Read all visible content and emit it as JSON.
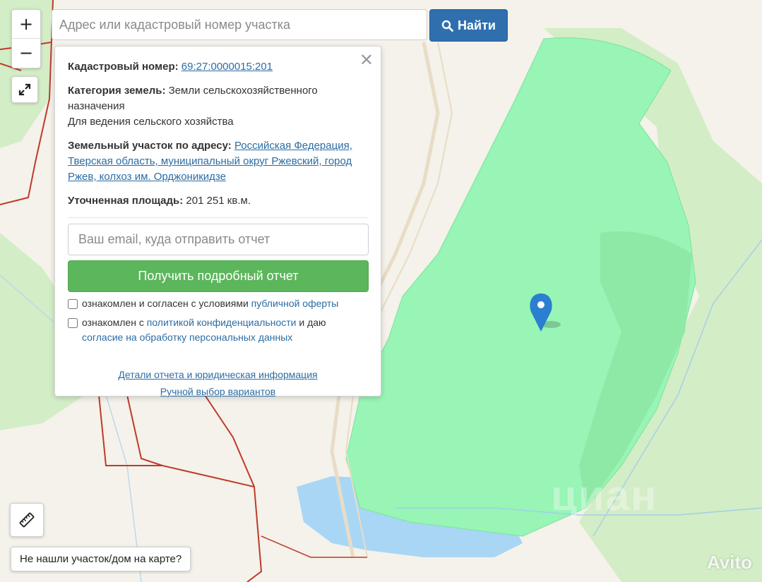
{
  "search": {
    "placeholder": "Адрес или кадастровый номер участка",
    "button_label": "Найти"
  },
  "map_controls": {
    "zoom_in": "+",
    "zoom_out": "−"
  },
  "popup": {
    "cadastral_label": "Кадастровый номер:",
    "cadastral_value": "69:27:0000015:201",
    "category_label": "Категория земель:",
    "category_value": "Земли сельскохозяйственного назначения",
    "usage": "Для ведения сельского хозяйства",
    "address_label": "Земельный участок по адресу:",
    "address_value": "Российская Федерация, Тверская область, муниципальный округ Ржевский, город Ржев, колхоз им. Орджоникидзе",
    "area_label": "Уточненная площадь:",
    "area_value": "201 251 кв.м.",
    "email_placeholder": "Ваш email, куда отправить отчет",
    "report_button": "Получить подробный отчет",
    "consent1_text": "ознакомлен и согласен с условиями",
    "consent1_link": "публичной оферты",
    "consent2_text_a": "ознакомлен с",
    "consent2_link_a": "политикой конфиденциальности",
    "consent2_text_b": "и даю",
    "consent2_link_b": "согласие на обработку персональных данных",
    "details_link": "Детали отчета и юридическая информация",
    "manual_link": "Ручной выбор вариантов"
  },
  "not_found_button": "Не нашли участок/дом на карте?",
  "watermarks": {
    "avito": "Avito",
    "cian": "циан"
  },
  "colors": {
    "parcel_fill": "#98f5b5",
    "water_fill": "#a9d6f5",
    "boundary_red": "#c0392b",
    "search_button": "#2f6fae",
    "report_button": "#5cb65c",
    "link": "#2b6ca3",
    "marker": "#2a7fcf"
  }
}
